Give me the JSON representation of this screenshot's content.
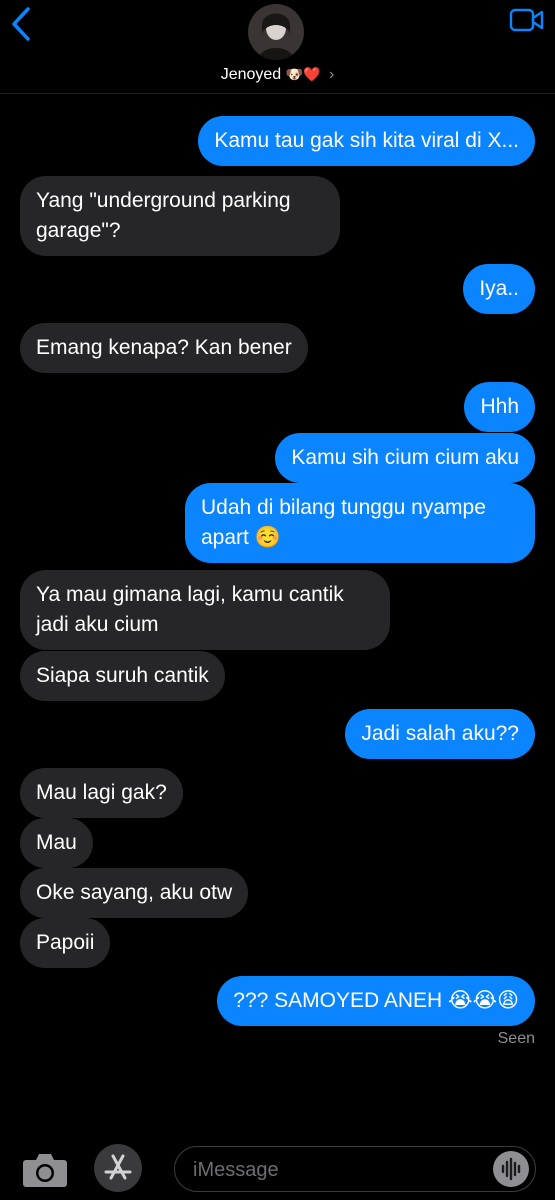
{
  "colors": {
    "background": "#000000",
    "outgoing": "#0a84ff",
    "incoming": "#262628",
    "accent": "#0a84ff"
  },
  "header": {
    "back_icon": "chevron-left-icon",
    "video_icon": "video-camera-icon",
    "contact_name": "Jenoyed",
    "contact_emojis": "🐶❤️",
    "chevron": "›"
  },
  "messages": [
    {
      "sender": "me",
      "text": "Kamu tau gak sih kita viral di X..."
    },
    {
      "sender": "them",
      "text": "Yang \"underground parking garage\"?"
    },
    {
      "sender": "me",
      "text": "Iya.."
    },
    {
      "sender": "them",
      "text": "Emang kenapa? Kan bener"
    },
    {
      "sender": "me",
      "text": "Hhh"
    },
    {
      "sender": "me",
      "text": "Kamu sih cium cium aku"
    },
    {
      "sender": "me",
      "text": "Udah di bilang tunggu nyampe apart ☺️"
    },
    {
      "sender": "them",
      "text": "Ya mau gimana lagi, kamu cantik jadi aku cium"
    },
    {
      "sender": "them",
      "text": "Siapa suruh cantik"
    },
    {
      "sender": "me",
      "text": "Jadi salah aku??"
    },
    {
      "sender": "them",
      "text": "Mau lagi gak?"
    },
    {
      "sender": "them",
      "text": "Mau"
    },
    {
      "sender": "them",
      "text": "Oke sayang, aku otw"
    },
    {
      "sender": "them",
      "text": "Papoii"
    },
    {
      "sender": "me",
      "text": "??? SAMOYED ANEH 😭😭😩"
    }
  ],
  "status": {
    "seen": "Seen"
  },
  "composer": {
    "camera_icon": "camera-icon",
    "appstore_icon": "app-store-icon",
    "placeholder": "iMessage",
    "audio_icon": "audio-waveform-icon"
  }
}
